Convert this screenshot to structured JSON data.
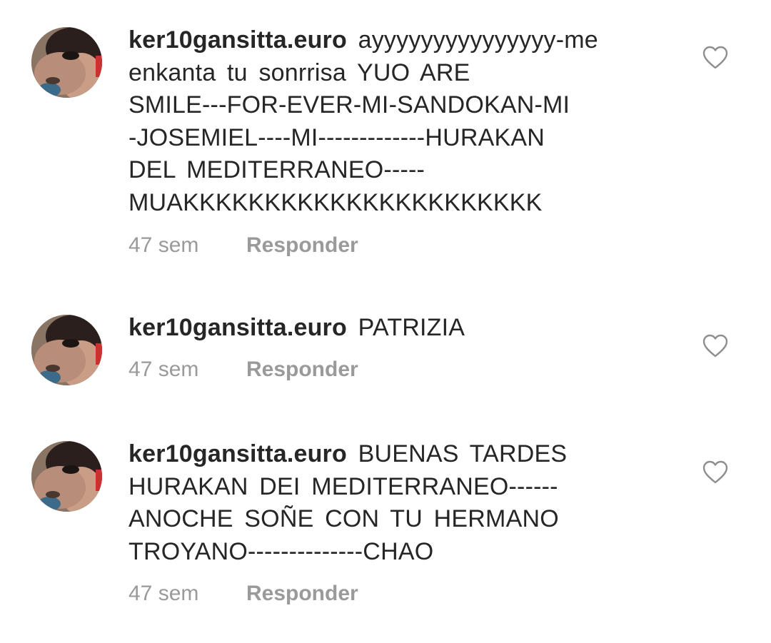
{
  "comments": [
    {
      "username": "ker10gansitta.euro",
      "lines": [
        "ayyyyyyyyyyyyyyy-me",
        "enkanta tu sonrrisa YUO ARE",
        "SMILE---FOR-EVER-MI-SANDOKAN-MI",
        "-JOSEMIEL----MI-------------HURAKAN",
        "DEL MEDITERRANEO-----",
        "MUAKKKKKKKKKKKKKKKKKKKKKK"
      ],
      "time": "47 sem",
      "reply_label": "Responder"
    },
    {
      "username": "ker10gansitta.euro",
      "lines": [
        "PATRIZIA"
      ],
      "time": "47 sem",
      "reply_label": "Responder"
    },
    {
      "username": "ker10gansitta.euro",
      "lines": [
        "BUENAS TARDES",
        "HURAKAN DEI MEDITERRANEO------",
        "ANOCHE SOÑE CON TU HERMANO",
        "TROYANO--------------CHAO"
      ],
      "time": "47 sem",
      "reply_label": "Responder"
    }
  ],
  "icons": {
    "like": "heart-outline-icon",
    "avatar": "profile-photo"
  },
  "colors": {
    "text": "#262626",
    "secondary": "#9a9a9a",
    "heart": "#8e8e8e"
  }
}
